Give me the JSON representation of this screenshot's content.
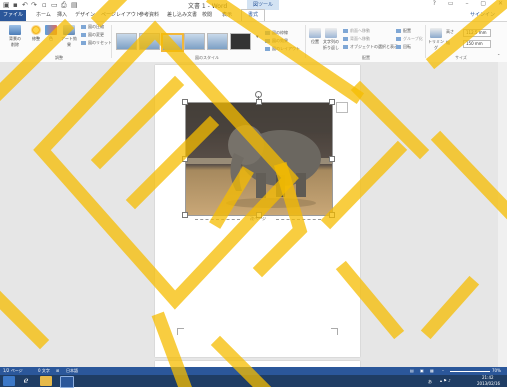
{
  "title_bar": {
    "doc_title": "文書 1 - Word",
    "context_group": "図ツール",
    "controls": [
      "?",
      "▭",
      "–",
      "▢",
      "✕"
    ]
  },
  "tabs": {
    "file": "ファイル",
    "items": [
      "ホーム",
      "挿入",
      "デザイン",
      "ページレイアウト",
      "参考資料",
      "差し込み文書",
      "校閲",
      "表示",
      "書式"
    ],
    "active": "書式",
    "signin": "サインイン"
  },
  "ribbon": {
    "adjust": {
      "buttons": [
        "背景の削除",
        "修整",
        "色",
        "アート効果"
      ],
      "small": [
        "図の圧縮",
        "図の変更",
        "図のリセット"
      ],
      "group": "調整"
    },
    "styles_group": "図のスタイル",
    "styles_small": [
      "図の枠線",
      "図の効果",
      "図のレイアウト"
    ],
    "arrange": {
      "buttons": [
        "位置",
        "文字列の折り返し"
      ],
      "small": [
        "前面へ移動",
        "背面へ移動",
        "オブジェクトの選択と表示"
      ],
      "small2": [
        "配置",
        "グループ化",
        "回転"
      ],
      "group": "配置"
    },
    "size": {
      "crop": "トリミング",
      "height_label": "高さ",
      "height": "112.5 mm",
      "width_label": "幅",
      "width": "150 mm",
      "group": "サイズ"
    }
  },
  "document": {
    "page_break": "改ページ"
  },
  "status": {
    "page": "1/2 ページ",
    "words": "0 文字",
    "lang": "日本語",
    "zoom": "70%"
  },
  "taskbar": {
    "time": "21:42",
    "date": "2013/02/16",
    "ime": "あ"
  },
  "colors": {
    "word_blue": "#2b579a",
    "taskbar": "#1f3d64",
    "watermark": "#f6bc00"
  }
}
